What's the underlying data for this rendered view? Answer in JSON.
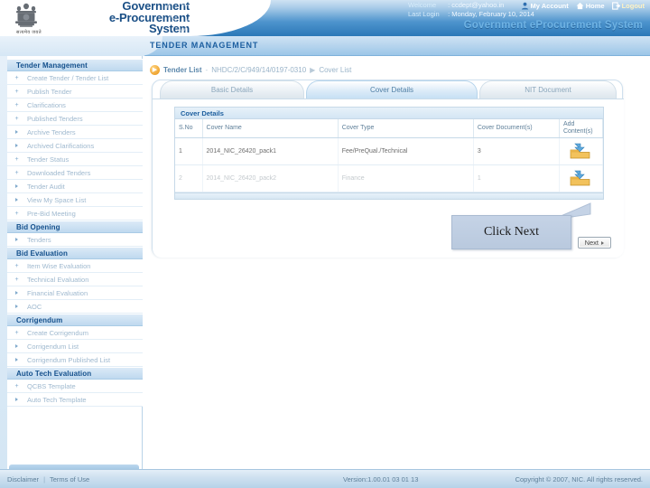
{
  "header": {
    "brand_line1": "Government",
    "brand_line2": "e-Procurement",
    "brand_line3": "System",
    "brand_sub": "सत्यमेव जयते",
    "welcome_label": "Welcome",
    "welcome_value": ": ccdept@yahoo.in",
    "lastlogin_label": "Last Login",
    "lastlogin_value": ": Monday, February 10, 2014",
    "system_title": "Government eProcurement System",
    "nav": [
      {
        "label": "My Account",
        "icon": "user-icon"
      },
      {
        "label": "Home",
        "icon": "home-icon"
      },
      {
        "label": "Logout",
        "icon": "logout-icon"
      }
    ]
  },
  "module_bar": {
    "title": "TENDER MANAGEMENT"
  },
  "sidebar": {
    "sections": [
      {
        "title": "Tender Management",
        "items": [
          {
            "label": "Create Tender / Tender List",
            "marker": "plus"
          },
          {
            "label": "Publish Tender",
            "marker": "plus"
          },
          {
            "label": "Clarifications",
            "marker": "plus"
          },
          {
            "label": "Published Tenders",
            "marker": "plus"
          },
          {
            "label": "Archive Tenders",
            "marker": "arrow"
          },
          {
            "label": "Archived Clarifications",
            "marker": "arrow"
          },
          {
            "label": "Tender Status",
            "marker": "plus"
          },
          {
            "label": "Downloaded Tenders",
            "marker": "plus"
          },
          {
            "label": "Tender Audit",
            "marker": "arrow"
          },
          {
            "label": "View My Space List",
            "marker": "arrow"
          },
          {
            "label": "Pre-Bid Meeting",
            "marker": "plus"
          }
        ]
      },
      {
        "title": "Bid Opening",
        "items": [
          {
            "label": "Tenders",
            "marker": "arrow"
          }
        ]
      },
      {
        "title": "Bid Evaluation",
        "items": [
          {
            "label": "Item Wise Evaluation",
            "marker": "plus"
          },
          {
            "label": "Technical Evaluation",
            "marker": "plus"
          },
          {
            "label": "Financial Evaluation",
            "marker": "arrow"
          },
          {
            "label": "AOC",
            "marker": "arrow"
          }
        ]
      },
      {
        "title": "Corrigendum",
        "items": [
          {
            "label": "Create Corrigendum",
            "marker": "plus"
          },
          {
            "label": "Corrigendum List",
            "marker": "arrow"
          },
          {
            "label": "Corrigendum Published List",
            "marker": "arrow"
          }
        ]
      },
      {
        "title": "Auto Tech Evaluation",
        "items": [
          {
            "label": "QCBS Template",
            "marker": "plus"
          },
          {
            "label": "Auto Tech Template",
            "marker": "arrow"
          }
        ]
      }
    ]
  },
  "breadcrumb": {
    "root": "Tender List",
    "sep1": "-",
    "tender_id": "NHDC/2/C/949/14/0197-0310",
    "sep2": "▶",
    "current": "Cover List"
  },
  "tabs": [
    {
      "label": "Basic Details",
      "active": false
    },
    {
      "label": "Cover Details",
      "active": true
    },
    {
      "label": "NIT Document",
      "active": false
    }
  ],
  "cover_table": {
    "title": "Cover Details",
    "columns": [
      "S.No",
      "Cover Name",
      "Cover Type",
      "Cover Document(s)",
      "Add Content(s)"
    ],
    "rows": [
      {
        "sno": "1",
        "cover_name": "2014_NIC_26420_pack1",
        "cover_type": "Fee/PreQual./Technical",
        "documents": "3",
        "add_icon": "upload-folder-icon"
      },
      {
        "sno": "2",
        "cover_name": "2014_NIC_26420_pack2",
        "cover_type": "Finance",
        "documents": "1",
        "add_icon": "upload-folder-icon"
      }
    ]
  },
  "next_button": {
    "label": "Next"
  },
  "callout": {
    "text": "Click Next"
  },
  "footer": {
    "disclaimer": "Disclaimer",
    "separator": "|",
    "terms": "Terms of Use",
    "version": "Version:1.00.01 03 01 13",
    "copyright": "Copyright © 2007, NIC. All rights reserved."
  },
  "colors": {
    "header_blue": "#2b78b8",
    "accent_blue": "#1d5fa0",
    "panel_border": "#cfe0ee",
    "callout_bg": "#c5d3e6",
    "logout_yellow": "#fff3c4"
  }
}
